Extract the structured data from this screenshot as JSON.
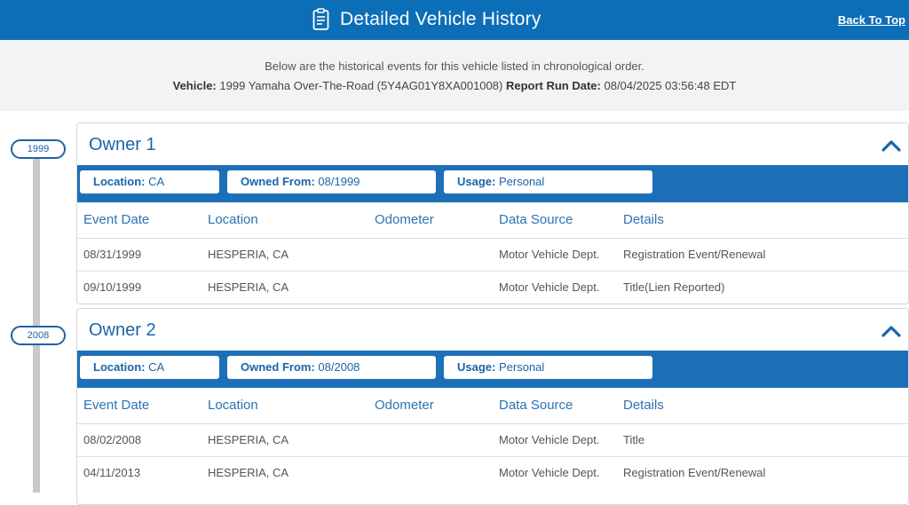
{
  "header": {
    "title": "Detailed Vehicle History",
    "back_to_top": "Back To Top",
    "icon": "document-icon",
    "color": "#0d6eb8"
  },
  "intro": {
    "description": "Below are the historical events for this vehicle listed in chronological order.",
    "vehicle_label": "Vehicle:",
    "vehicle_value": "1999 Yamaha Over-The-Road (5Y4AG01Y8XA001008)",
    "run_date_label": "Report Run Date:",
    "run_date_value": "08/04/2025 03:56:48 EDT"
  },
  "columns": [
    "Event Date",
    "Location",
    "Odometer",
    "Data Source",
    "Details"
  ],
  "owners": [
    {
      "year": "1999",
      "title": "Owner 1",
      "location_label": "Location:",
      "location": "CA",
      "owned_from_label": "Owned From:",
      "owned_from": "08/1999",
      "usage_label": "Usage:",
      "usage": "Personal",
      "events": [
        {
          "date": "08/31/1999",
          "location": "HESPERIA, CA",
          "odometer": "",
          "source": "Motor Vehicle Dept.",
          "details": "Registration Event/Renewal"
        },
        {
          "date": "09/10/1999",
          "location": "HESPERIA, CA",
          "odometer": "",
          "source": "Motor Vehicle Dept.",
          "details": "Title(Lien Reported)"
        }
      ]
    },
    {
      "year": "2008",
      "title": "Owner 2",
      "location_label": "Location:",
      "location": "CA",
      "owned_from_label": "Owned From:",
      "owned_from": "08/2008",
      "usage_label": "Usage:",
      "usage": "Personal",
      "events": [
        {
          "date": "08/02/2008",
          "location": "HESPERIA, CA",
          "odometer": "",
          "source": "Motor Vehicle Dept.",
          "details": "Title"
        },
        {
          "date": "04/11/2013",
          "location": "HESPERIA, CA",
          "odometer": "",
          "source": "Motor Vehicle Dept.",
          "details": "Registration Event/Renewal"
        }
      ]
    }
  ]
}
